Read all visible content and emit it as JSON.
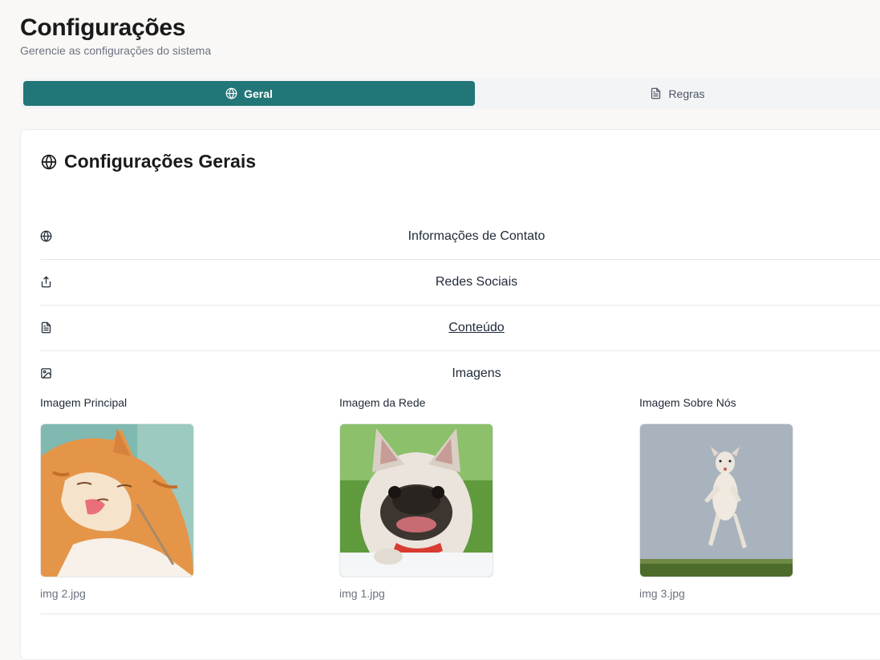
{
  "header": {
    "title": "Configurações",
    "subtitle": "Gerencie as configurações do sistema"
  },
  "tabs": [
    {
      "label": "Geral",
      "icon": "globe-icon",
      "active": true
    },
    {
      "label": "Regras",
      "icon": "file-text-icon",
      "active": false
    }
  ],
  "card": {
    "title": "Configurações Gerais",
    "icon": "globe-icon"
  },
  "sections": [
    {
      "label": "Informações de Contato",
      "icon": "globe-icon"
    },
    {
      "label": "Redes Sociais",
      "icon": "share-icon"
    },
    {
      "label": "Conteúdo",
      "icon": "file-text-icon"
    },
    {
      "label": "Imagens",
      "icon": "image-icon"
    }
  ],
  "images": [
    {
      "label": "Imagem Principal",
      "file": "img 2.jpg",
      "subject": "orange-white cat licking paw"
    },
    {
      "label": "Imagem da Rede",
      "file": "img 1.jpg",
      "subject": "french bulldog with red collar"
    },
    {
      "label": "Imagem Sobre Nós",
      "file": "img 3.jpg",
      "subject": "white dog jumping over grass"
    }
  ],
  "colors": {
    "accent": "#237677",
    "background": "#f9f8f6",
    "card": "#ffffff",
    "muted_text": "#6b7280"
  }
}
